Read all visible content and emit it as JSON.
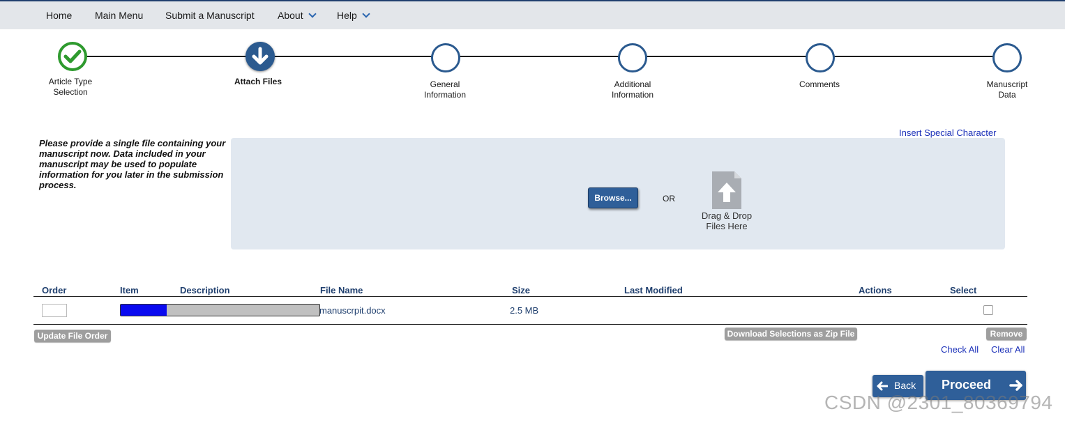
{
  "nav": {
    "items": [
      {
        "label": "Home"
      },
      {
        "label": "Main Menu"
      },
      {
        "label": "Submit a Manuscript"
      },
      {
        "label": "About"
      },
      {
        "label": "Help"
      }
    ]
  },
  "steps": [
    {
      "line1": "Article Type",
      "line2": "Selection",
      "state": "done"
    },
    {
      "line1": "Attach Files",
      "line2": "",
      "state": "current"
    },
    {
      "line1": "General",
      "line2": "Information",
      "state": "pending"
    },
    {
      "line1": "Additional",
      "line2": "Information",
      "state": "pending"
    },
    {
      "line1": "Comments",
      "line2": "",
      "state": "pending"
    },
    {
      "line1": "Manuscript",
      "line2": "Data",
      "state": "pending"
    }
  ],
  "instruction": "Please provide a single file containing your manuscript now. Data included in your manuscript may be used to populate information for you later in the submission process.",
  "insert_special_character": "Insert Special Character",
  "dropzone": {
    "browse_label": "Browse...",
    "or_label": "OR",
    "drop_line1": "Drag & Drop",
    "drop_line2": "Files Here"
  },
  "table": {
    "headers": {
      "order": "Order",
      "item": "Item",
      "description": "Description",
      "file_name": "File Name",
      "size": "Size",
      "last_modified": "Last Modified",
      "actions": "Actions",
      "select": "Select"
    },
    "rows": [
      {
        "order": "",
        "upload_progress": 0.23,
        "file_name": "manuscrpit.docx",
        "size": "2.5 MB",
        "last_modified": ""
      }
    ]
  },
  "buttons": {
    "update_order": "Update File Order",
    "download_zip": "Download Selections as Zip File",
    "remove": "Remove",
    "check_all": "Check All",
    "clear_all": "Clear All",
    "back": "Back",
    "proceed": "Proceed"
  },
  "colors": {
    "accent": "#2f5f99",
    "done_green": "#2e9a2e",
    "progress_fill": "#0a0af0",
    "link": "#1a2fb8"
  },
  "watermark": "CSDN @2301_80369794"
}
